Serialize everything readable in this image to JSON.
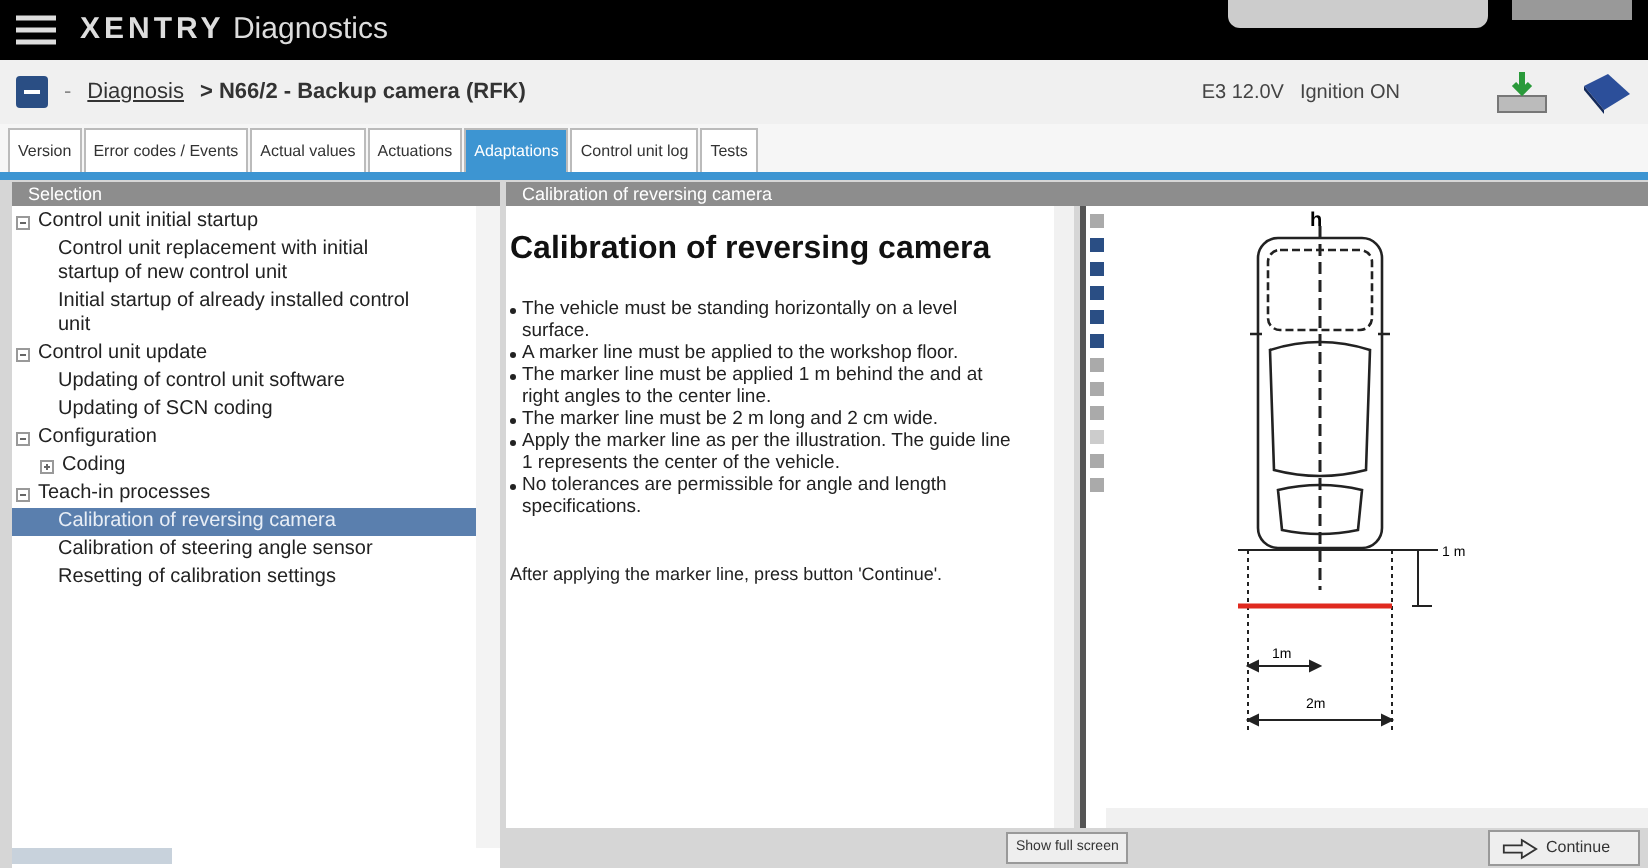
{
  "app_title": {
    "brand": "XENTRY",
    "product": "Diagnostics"
  },
  "breadcrumb": {
    "separator": "-",
    "link": "Diagnosis",
    "current": "> N66/2 - Backup camera (RFK)"
  },
  "status": {
    "voltage": "E3 12.0V",
    "ignition": "Ignition ON"
  },
  "tabs": [
    {
      "label": "Version",
      "selected": false
    },
    {
      "label": "Error codes / Events",
      "selected": false
    },
    {
      "label": "Actual values",
      "selected": false
    },
    {
      "label": "Actuations",
      "selected": false
    },
    {
      "label": "Adaptations",
      "selected": true
    },
    {
      "label": "Control unit log",
      "selected": false
    },
    {
      "label": "Tests",
      "selected": false
    }
  ],
  "selection": {
    "title": "Selection",
    "items": [
      {
        "label": "Control unit initial startup",
        "expanded": true,
        "children": [
          {
            "label": "Control unit replacement with initial startup of new control unit",
            "selected": false
          },
          {
            "label": "Initial startup of already installed control unit",
            "selected": false
          }
        ]
      },
      {
        "label": "Control unit update",
        "expanded": true,
        "children": [
          {
            "label": "Updating of control unit software",
            "selected": false
          },
          {
            "label": "Updating of SCN coding",
            "selected": false
          }
        ]
      },
      {
        "label": "Configuration",
        "expanded": true,
        "children": [
          {
            "label": "Coding",
            "expanded": false
          }
        ]
      },
      {
        "label": "Teach-in processes",
        "expanded": true,
        "children": [
          {
            "label": "Calibration of reversing camera",
            "selected": true
          },
          {
            "label": "Calibration of steering angle sensor",
            "selected": false
          },
          {
            "label": "Resetting of calibration settings",
            "selected": false
          }
        ]
      }
    ]
  },
  "content": {
    "title": "Calibration of reversing camera",
    "heading": "Calibration of reversing camera",
    "bullets": [
      "The vehicle must be standing horizontally on a level surface.",
      "A marker line must be applied to the workshop floor.",
      "The marker line must be applied 1 m behind the and at right angles to the center line.",
      "The marker line must be 2 m long and 2 cm wide.",
      "Apply the marker line as per the illustration. The guide line 1 represents the center of the vehicle.",
      "No tolerances are permissible for angle and length specifications."
    ],
    "note": "After applying the marker line, press button 'Continue'."
  },
  "illustration": {
    "guide_label": "h",
    "distance_label": "1 m",
    "half_label": "1m",
    "width_label": "2m"
  },
  "buttons": {
    "full_screen": "Show full screen",
    "continue": "Continue"
  }
}
